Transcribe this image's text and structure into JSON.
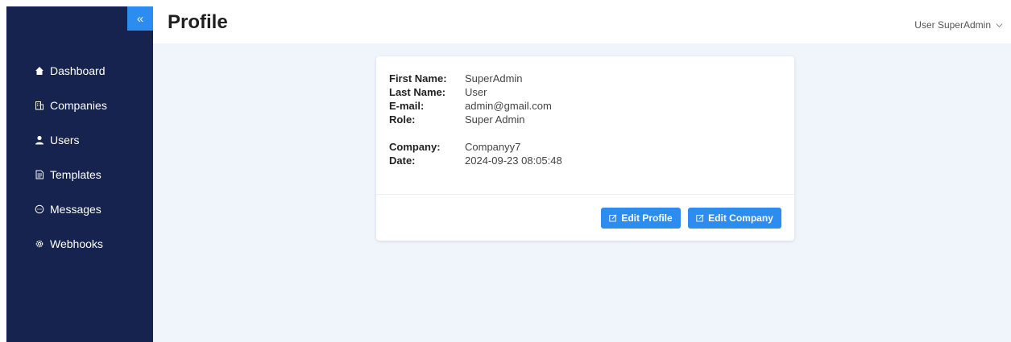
{
  "sidebar": {
    "collapse_glyph": "«",
    "items": [
      {
        "label": "Dashboard",
        "icon": "home-icon"
      },
      {
        "label": "Companies",
        "icon": "building-icon"
      },
      {
        "label": "Users",
        "icon": "user-icon"
      },
      {
        "label": "Templates",
        "icon": "document-icon"
      },
      {
        "label": "Messages",
        "icon": "message-icon"
      },
      {
        "label": "Webhooks",
        "icon": "gear-icon"
      }
    ]
  },
  "header": {
    "title": "Profile",
    "user_name": "User SuperAdmin"
  },
  "profile": {
    "first_name": {
      "label": "First Name:",
      "value": "SuperAdmin"
    },
    "last_name": {
      "label": "Last Name:",
      "value": "User"
    },
    "email": {
      "label": "E-mail:",
      "value": "admin@gmail.com"
    },
    "role": {
      "label": "Role:",
      "value": "Super Admin"
    },
    "company": {
      "label": "Company:",
      "value": "Companyy7"
    },
    "date": {
      "label": "Date:",
      "value": "2024-09-23 08:05:48"
    }
  },
  "actions": {
    "edit_profile": "Edit Profile",
    "edit_company": "Edit Company"
  },
  "colors": {
    "sidebar_bg": "#16234f",
    "accent": "#2d8cf0",
    "content_bg": "#f0f5fc"
  }
}
